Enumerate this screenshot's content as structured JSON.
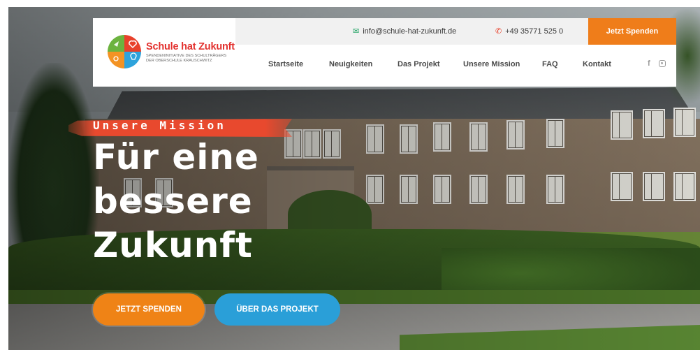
{
  "brand": {
    "name": "Schule hat Zukunft",
    "tagline": "Spendeninitiative des Schulträgers der Oberschule Krauschwitz"
  },
  "topbar": {
    "email": "info@schule-hat-zukunft.de",
    "phone": "+49 35771 525 0",
    "donate_label": "Jetzt Spenden"
  },
  "nav": {
    "items": [
      {
        "label": "Startseite"
      },
      {
        "label": "Neuigkeiten"
      },
      {
        "label": "Das Projekt"
      },
      {
        "label": "Unsere Mission"
      },
      {
        "label": "FAQ"
      },
      {
        "label": "Kontakt"
      }
    ],
    "social": [
      "facebook-icon",
      "instagram-icon"
    ]
  },
  "hero": {
    "eyebrow": "Unsere Mission",
    "headline": [
      "Für eine",
      "bessere",
      "Zukunft"
    ],
    "buttons": {
      "donate": "JETZT SPENDEN",
      "project": "ÜBER DAS PROJEKT"
    }
  },
  "colors": {
    "accent_orange": "#ef7d1a",
    "accent_blue": "#2a9fd8",
    "brand_red": "#e3322f",
    "email_green": "#18a05e"
  }
}
